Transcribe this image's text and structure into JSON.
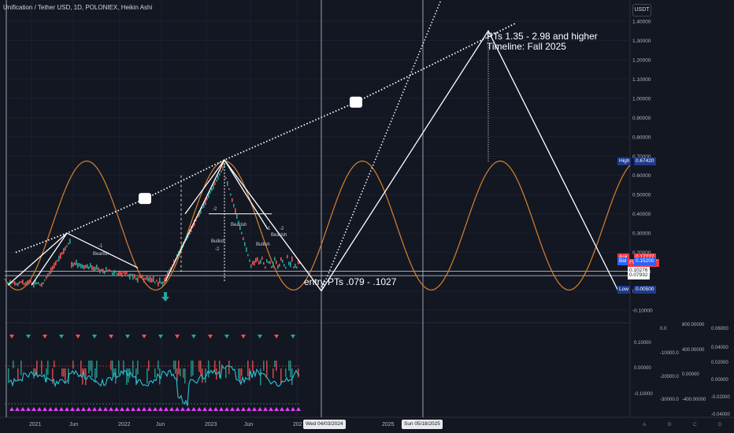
{
  "header": {
    "title": "Unification / Tether USD, 1D, POLONIEX, Heikin Ashi",
    "currency_button": "USDT"
  },
  "annotations": {
    "price_targets": "PTs 1.35 - 2.98 and higher",
    "timeline": "Timeline: Fall 2025",
    "entry": "entry PTs .079 - .1027",
    "pattern_labels": [
      "-1",
      "Bearish",
      "-2",
      "Bearish",
      "Bullish",
      "-2",
      "Bearish",
      "Bullish",
      "-1",
      "-2"
    ]
  },
  "badges": [
    {
      "name": "high-badge",
      "label": "High",
      "value": "0.67420",
      "color": "#1e3a8a",
      "price": 0.6742
    },
    {
      "name": "ask-badge",
      "label": "Ask",
      "value": "0.17227",
      "color": "#f23645",
      "price": 0.17227
    },
    {
      "name": "symbol-badge",
      "label": "",
      "value": "FUNDUSDT",
      "color": "#f23645",
      "price": 0.145
    },
    {
      "name": "bid-badge",
      "label": "Bid",
      "value": "0.15200",
      "color": "#2962ff",
      "price": 0.152
    },
    {
      "name": "last-badge-1",
      "label": "",
      "value": "0.10276",
      "color": "#ffffff",
      "price": 0.10276
    },
    {
      "name": "last-badge-2",
      "label": "",
      "value": "0.07932",
      "color": "#ffffff",
      "price": 0.07932
    },
    {
      "name": "low-badge",
      "label": "Low",
      "value": "0.00500",
      "color": "#1e3a8a",
      "price": 0.005
    }
  ],
  "time_axis": {
    "labels": [
      "2021",
      "Jun",
      "2022",
      "Jun",
      "2023",
      "Jun",
      "202",
      "2025"
    ],
    "highlighted_dates": [
      "Wed 04/03/2024",
      "Sun 05/18/2025"
    ],
    "corner_buttons": [
      "A",
      "B",
      "C",
      "D"
    ]
  },
  "chart_data": {
    "type": "line",
    "price_axis": {
      "ticks": [
        "1.40000",
        "1.30000",
        "1.20000",
        "1.10000",
        "1.00000",
        "0.90000",
        "0.80000",
        "0.70000",
        "0.60000",
        "0.50000",
        "0.40000",
        "0.30000",
        "0.20000",
        "0.10000",
        "0.00000",
        "-0.10000"
      ],
      "range": [
        -0.1,
        1.4
      ]
    },
    "projection_path": [
      {
        "date": "2024-04-03",
        "price": 0.0
      },
      {
        "date": "2025-05-18",
        "price": 1.35
      },
      {
        "date": "2026-08",
        "price": 0.0
      }
    ],
    "resistance_trendline": [
      {
        "date": "2020-09",
        "price": 0.08
      },
      {
        "date": "2021-03",
        "price": 0.3
      },
      {
        "date": "2023-02",
        "price": 0.68
      },
      {
        "date": "2025-06",
        "price": 1.42
      }
    ],
    "sine_cycle": {
      "high": 0.6742,
      "low": 0.005
    },
    "oscillator_axes": {
      "axis1": [
        "0.10000",
        "0.00000",
        "-0.10000"
      ],
      "axis2": [
        "0.0",
        "-10000.0",
        "-20000.0",
        "-30000.0"
      ],
      "axis3": [
        "800.00000",
        "400.00000",
        "0.00000",
        "-400.00000"
      ],
      "axis4": [
        "0.06000",
        "0.04000",
        "0.02000",
        "0.00000",
        "-0.02000",
        "-0.04000"
      ]
    },
    "colors": {
      "sine": "#d9822b",
      "trend": "#ffffff",
      "oscillator": "#26c6da",
      "bull": "#26a69a",
      "bear": "#ef5350",
      "signal": "#e040fb"
    }
  }
}
